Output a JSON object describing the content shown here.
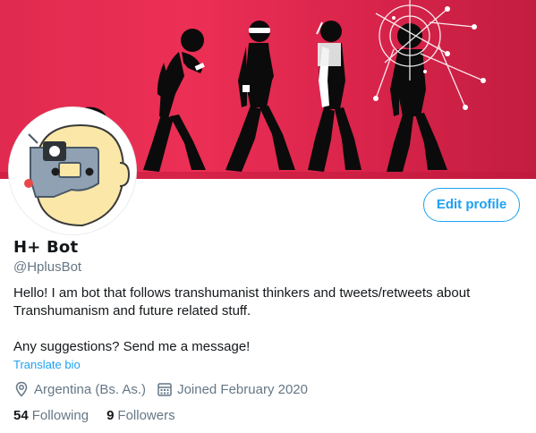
{
  "profile": {
    "name": "H+ Bot",
    "handle": "@HplusBot",
    "edit_label": "Edit profile",
    "bio_line1": "Hello! I am bot that follows transhumanist thinkers and tweets/retweets about Transhumanism and future related stuff.",
    "bio_line2": "Any suggestions? Send me a message!",
    "translate_label": "Translate bio",
    "location": "Argentina (Bs. As.)",
    "joined": "Joined February 2020",
    "following_count": "54",
    "following_label": "Following",
    "followers_count": "9",
    "followers_label": "Followers"
  },
  "colors": {
    "accent": "#1da1f2",
    "banner": "#e12a4f",
    "secondary_text": "#657786"
  },
  "icons": {
    "location": "location-pin-icon",
    "joined": "calendar-icon"
  }
}
